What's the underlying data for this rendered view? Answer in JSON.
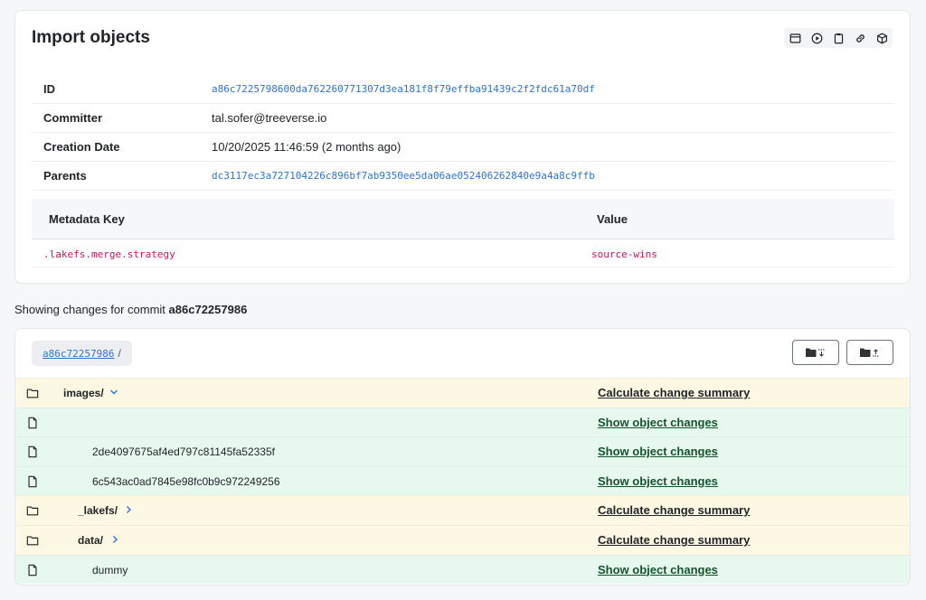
{
  "commit": {
    "title": "Import objects",
    "toolbar_icons": [
      "browse-objects-icon",
      "play-icon",
      "clipboard-icon",
      "link-icon",
      "cube-icon"
    ],
    "info": [
      {
        "key": "ID",
        "value": "a86c7225798600da762260771307d3ea181f8f79effba91439c2f2fdc61a70df",
        "type": "link"
      },
      {
        "key": "Committer",
        "value": "tal.sofer@treeverse.io",
        "type": "text"
      },
      {
        "key": "Creation Date",
        "value": "10/20/2025 11:46:59 (2 months ago)",
        "type": "text"
      },
      {
        "key": "Parents",
        "value": "dc3117ec3a727104226c896bf7ab9350ee5da06ae052406262840e9a4a8c9ffb",
        "type": "link"
      }
    ],
    "metadata": {
      "header_key": "Metadata Key",
      "header_value": "Value",
      "rows": [
        {
          "key": ".lakefs.merge.strategy",
          "value": "source-wins"
        }
      ]
    }
  },
  "changes": {
    "showing_prefix": "Showing changes for commit",
    "commit_short": "a86c72257986",
    "breadcrumb": {
      "ref": "a86c72257986",
      "sep": "/"
    },
    "rows": [
      {
        "kind": "dir",
        "status": "mod",
        "name": "images/",
        "indent": 0,
        "expanded": true,
        "action": "Calculate change summary"
      },
      {
        "kind": "file",
        "status": "add",
        "name": "",
        "indent": 1,
        "action": "Show object changes"
      },
      {
        "kind": "file",
        "status": "add",
        "name": "2de4097675af4ed797c81145fa52335f",
        "indent": 1,
        "action": "Show object changes"
      },
      {
        "kind": "file",
        "status": "add",
        "name": "6c543ac0ad7845e98fc0b9c972249256",
        "indent": 1,
        "action": "Show object changes"
      },
      {
        "kind": "dir",
        "status": "mod",
        "name": "_lakefs/",
        "indent": 1,
        "expanded": false,
        "action": "Calculate change summary"
      },
      {
        "kind": "dir",
        "status": "mod",
        "name": "data/",
        "indent": 1,
        "expanded": false,
        "action": "Calculate change summary"
      },
      {
        "kind": "file",
        "status": "add",
        "name": "dummy",
        "indent": 2,
        "action": "Show object changes"
      }
    ]
  },
  "colors": {
    "link": "#2f74d0",
    "modified_bg": "#fdf8e3",
    "added_bg": "#e7f8ef",
    "metadata_text": "#c2185b"
  }
}
